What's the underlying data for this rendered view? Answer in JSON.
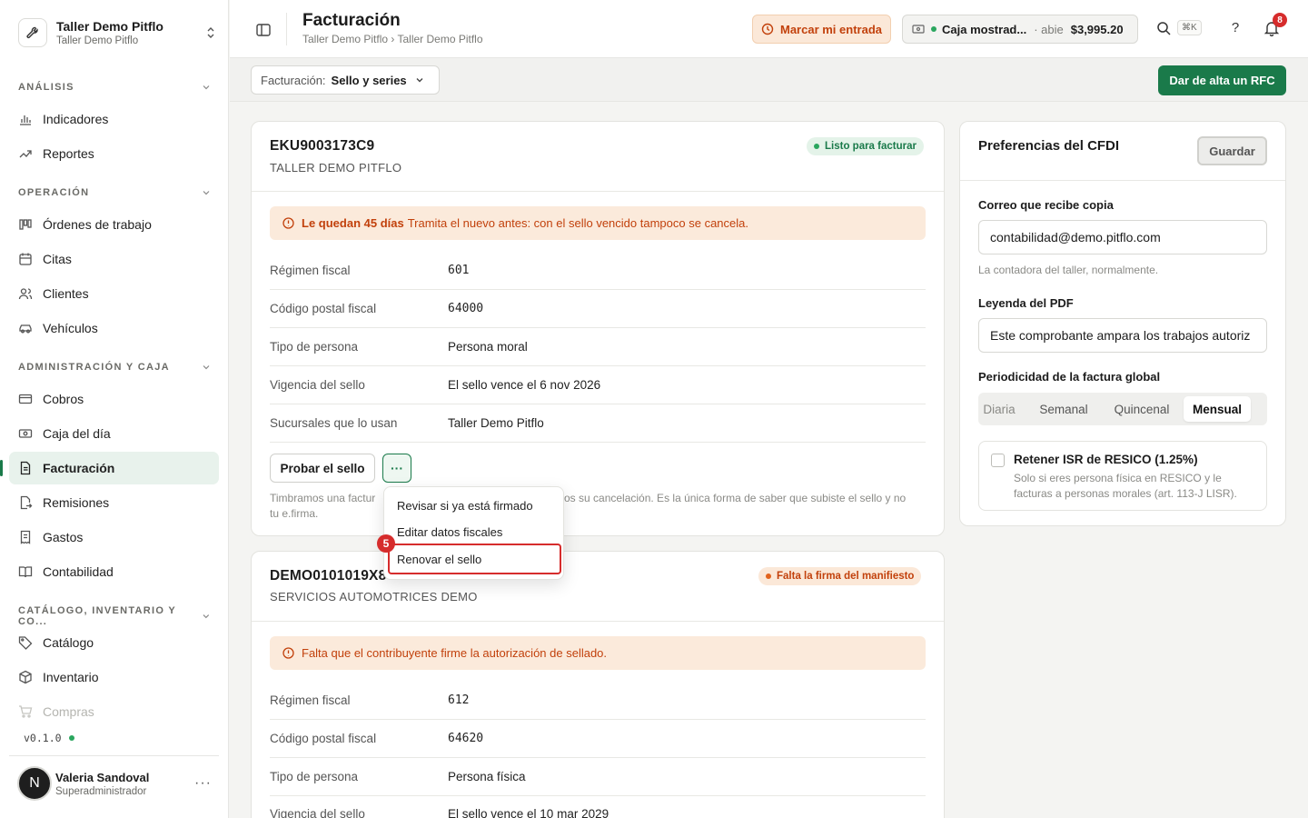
{
  "workspace": {
    "name": "Taller Demo Pitflo",
    "sub": "Taller Demo Pitflo"
  },
  "sidebar": {
    "sections": [
      {
        "label": "ANÁLISIS",
        "items": [
          "Indicadores",
          "Reportes"
        ]
      },
      {
        "label": "OPERACIÓN",
        "items": [
          "Órdenes de trabajo",
          "Citas",
          "Clientes",
          "Vehículos"
        ]
      },
      {
        "label": "ADMINISTRACIÓN Y CAJA",
        "items": [
          "Cobros",
          "Caja del día",
          "Facturación",
          "Remisiones",
          "Gastos",
          "Contabilidad"
        ]
      },
      {
        "label": "CATÁLOGO, INVENTARIO Y CO...",
        "items": [
          "Catálogo",
          "Inventario",
          "Compras"
        ]
      }
    ],
    "active_item": "Facturación",
    "version": "v0.1.0",
    "user": {
      "initial": "N",
      "name": "Valeria Sandoval",
      "role": "Superadministrador"
    }
  },
  "header": {
    "title": "Facturación",
    "breadcrumb": "Taller Demo Pitflo › Taller Demo Pitflo",
    "entrada_label": "Marcar mi entrada",
    "caja": {
      "name": "Caja mostrad...",
      "state": "abie",
      "amount": "$3,995.20"
    },
    "search_shortcut": "⌘K",
    "help_label": "?",
    "notification_count": "8"
  },
  "filter": {
    "prefix": "Facturación:",
    "value": "Sello y series",
    "add_rfc_label": "Dar de alta un RFC"
  },
  "emisores": [
    {
      "rfc": "EKU9003173C9",
      "razon": "TALLER DEMO PITFLO",
      "status": "Listo para facturar",
      "alert_bold": "Le quedan 45 días",
      "alert_text": "Tramita el nuevo antes: con el sello vencido tampoco se cancela.",
      "rows": [
        {
          "label": "Régimen fiscal",
          "value": "601"
        },
        {
          "label": "Código postal fiscal",
          "value": "64000"
        },
        {
          "label": "Tipo de persona",
          "value": "Persona moral"
        },
        {
          "label": "Vigencia del sello",
          "value": "El sello vence el 6 nov 2026"
        },
        {
          "label": "Sucursales que lo usan",
          "value": "Taller Demo Pitflo"
        }
      ],
      "test_label": "Probar el sello",
      "more_label": "···",
      "help_a": "Timbramos una factur",
      "help_b": "os su cancelación. Es la única forma de saber que subiste el sello y no",
      "help_c": "tu e.firma."
    },
    {
      "rfc": "DEMO0101019X8",
      "razon": "SERVICIOS AUTOMOTRICES DEMO",
      "status": "Falta la firma del manifiesto",
      "alert_text": "Falta que el contribuyente firme la autorización de sellado.",
      "rows": [
        {
          "label": "Régimen fiscal",
          "value": "612"
        },
        {
          "label": "Código postal fiscal",
          "value": "64620"
        },
        {
          "label": "Tipo de persona",
          "value": "Persona física"
        },
        {
          "label": "Vigencia del sello",
          "value": "El sello vence el 10 mar 2029"
        }
      ]
    }
  ],
  "menu": {
    "items": [
      "Revisar si ya está firmado",
      "Editar datos fiscales",
      "Renovar el sello"
    ],
    "step": "5"
  },
  "preferences": {
    "title": "Preferencias del CFDI",
    "save_label": "Guardar",
    "email_label": "Correo que recibe copia",
    "email_value": "contabilidad@demo.pitflo.com",
    "email_hint": "La contadora del taller, normalmente.",
    "legend_label": "Leyenda del PDF",
    "legend_value": "Este comprobante ampara los trabajos autoriz",
    "period_label": "Periodicidad de la factura global",
    "periods": [
      "Diaria",
      "Semanal",
      "Quincenal",
      "Mensual"
    ],
    "period_selected": "Mensual",
    "isr_title": "Retener ISR de RESICO (1.25%)",
    "isr_desc": "Solo si eres persona física en RESICO y le facturas a personas morales (art. 113-J LISR).",
    "isr_checked": false
  },
  "colors": {
    "accent": "#1a7a4a",
    "warning": "#c2410c",
    "danger": "#d62c2c"
  }
}
